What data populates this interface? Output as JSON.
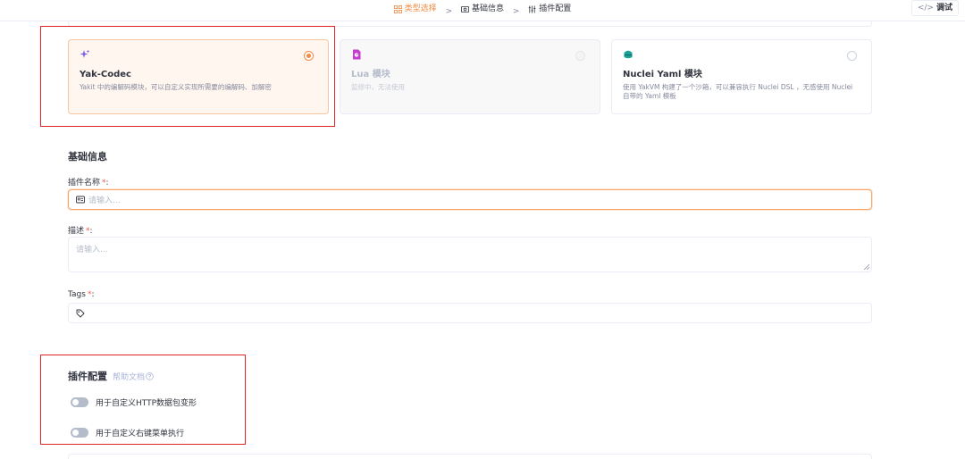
{
  "steps": [
    {
      "label": "类型选择",
      "active": true,
      "icon": "grid-icon"
    },
    {
      "label": "基础信息",
      "active": false,
      "icon": "info-card-icon"
    },
    {
      "label": "插件配置",
      "active": false,
      "icon": "sliders-icon"
    }
  ],
  "step_separator": ">",
  "debug_button": {
    "icon": "</>",
    "label": "调试"
  },
  "plugin_types": [
    {
      "title": "Yak-Codec",
      "desc": "Yakit 中的编解码模块，可以自定义实现所需要的编解码、加解密",
      "icon": "sparkle-icon",
      "selected": true,
      "disabled": false
    },
    {
      "title": "Lua 模块",
      "desc": "监修中，无法使用",
      "icon": "lua-file-icon",
      "selected": false,
      "disabled": true
    },
    {
      "title": "Nuclei Yaml 模块",
      "desc": "使用 YakVM 构建了一个沙箱，可以兼容执行 Nuclei DSL ，无感使用 Nuclei 自带的 Yaml 模板",
      "icon": "nuclei-icon",
      "selected": false,
      "disabled": false
    }
  ],
  "basic_info": {
    "title": "基础信息",
    "name_label": "插件名称",
    "name_placeholder": "请输入...",
    "desc_label": "描述",
    "desc_placeholder": "请输入...",
    "tags_label": "Tags",
    "required_mark": "*",
    "colon": ":"
  },
  "plugin_config": {
    "title": "插件配置",
    "help_link": "帮助文档",
    "switches": [
      {
        "label": "用于自定义HTTP数据包变形",
        "on": false
      },
      {
        "label": "用于自定义右键菜单执行",
        "on": false
      }
    ]
  },
  "colors": {
    "accent": "#f28b44",
    "highlight_box": "#e02424"
  }
}
